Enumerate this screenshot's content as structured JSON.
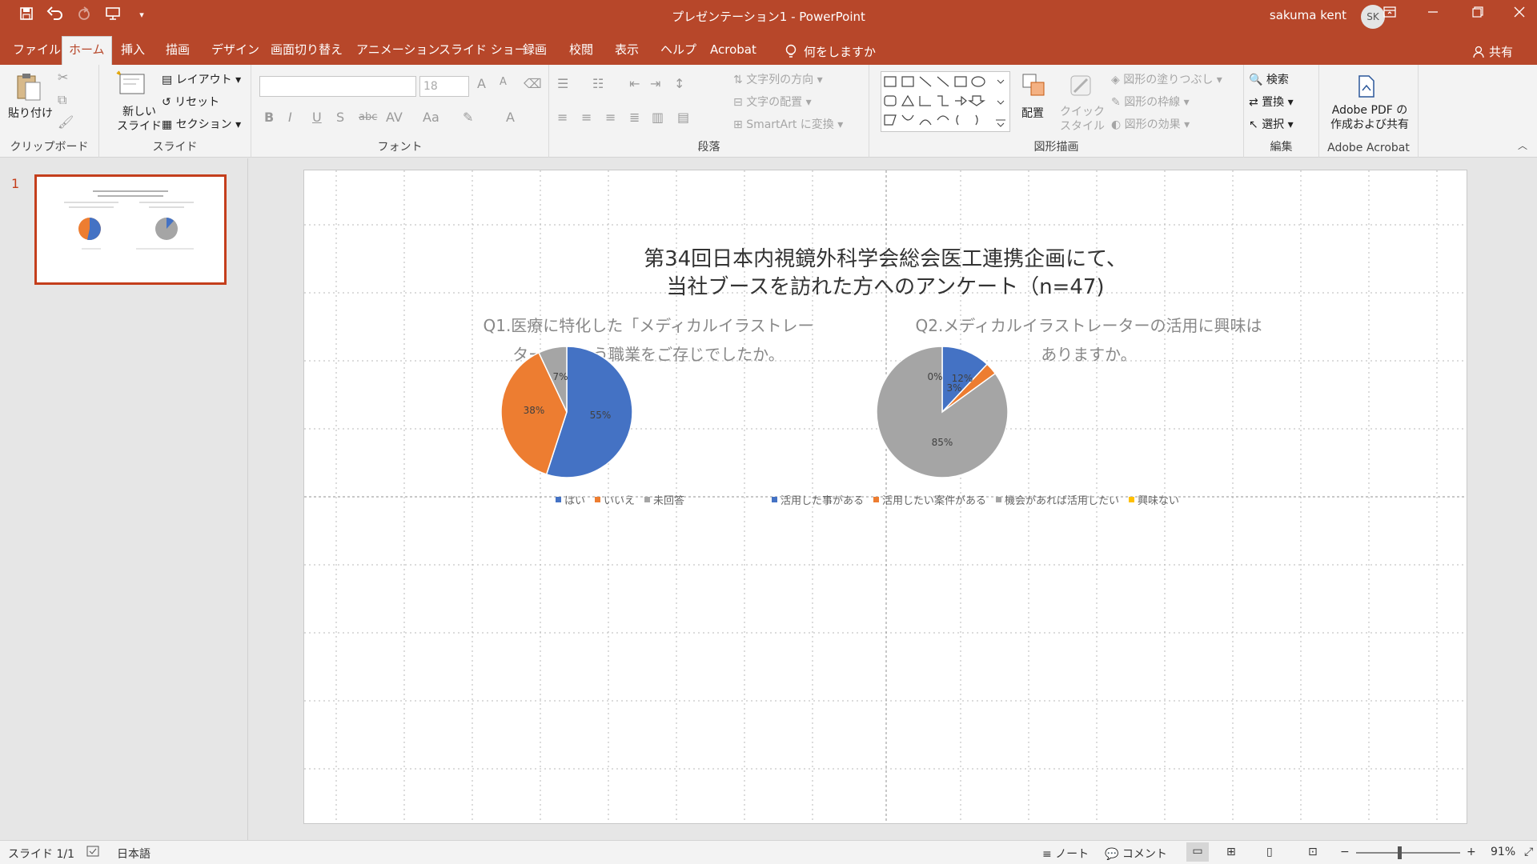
{
  "titlebar": {
    "title": "プレゼンテーション1  -  PowerPoint",
    "user_name": "sakuma kent",
    "avatar_initials": "SK"
  },
  "tabs": [
    "ファイル",
    "ホーム",
    "挿入",
    "描画",
    "デザイン",
    "画面切り替え",
    "アニメーション",
    "スライド ショー",
    "録画",
    "校閲",
    "表示",
    "ヘルプ",
    "Acrobat"
  ],
  "tell_me": "何をしますか",
  "share_label": "共有",
  "ribbon": {
    "clipboard": {
      "paste": "貼り付け",
      "label": "クリップボード"
    },
    "slides": {
      "new_slide_line1": "新しい",
      "new_slide_line2": "スライド",
      "layout": "レイアウト",
      "reset": "リセット",
      "section": "セクション",
      "label": "スライド"
    },
    "font": {
      "font_size": "18",
      "label": "フォント"
    },
    "paragraph": {
      "text_direction": "文字列の方向",
      "align_text": "文字の配置",
      "smartart": "SmartArt に変換",
      "label": "段落"
    },
    "drawing": {
      "arrange": "配置",
      "quick_style_line1": "クイック",
      "quick_style_line2": "スタイル",
      "shape_fill": "図形の塗りつぶし",
      "shape_outline": "図形の枠線",
      "shape_effects": "図形の効果",
      "label": "図形描画"
    },
    "editing": {
      "find": "検索",
      "replace": "置換",
      "select": "選択",
      "label": "編集"
    },
    "acrobat": {
      "line1": "Adobe PDF の",
      "line2": "作成および共有",
      "label": "Adobe Acrobat"
    }
  },
  "slide_pane": {
    "slide_number": "1"
  },
  "slide": {
    "title_line1": "第34回日本内視鏡外科学会総会医工連携企画にて、",
    "title_line2": "当社ブースを訪れた方へのアンケート（n=47)",
    "q1_line1": "Q1.医療に特化した「メディカルイラストレー",
    "q1_line2": "ター」という職業をご存じでしたか。",
    "q2_line1": "Q2.メディカルイラストレーターの活用に興味は",
    "q2_line2": "ありますか。"
  },
  "chart_data": [
    {
      "type": "pie",
      "categories": [
        "はい",
        "いいえ",
        "未回答"
      ],
      "values": [
        55,
        38,
        7
      ],
      "labels": [
        "55%",
        "38%",
        "7%"
      ],
      "colors": [
        "#4472c4",
        "#ed7d31",
        "#a5a5a5"
      ],
      "legend": "bottom"
    },
    {
      "type": "pie",
      "categories": [
        "活用した事がある",
        "活用したい案件がある",
        "機会があれば活用したい",
        "興味ない"
      ],
      "values": [
        12,
        3,
        85,
        0
      ],
      "labels": [
        "12%",
        "3%",
        "85%",
        "0%"
      ],
      "colors": [
        "#4472c4",
        "#ed7d31",
        "#a5a5a5",
        "#ffc000"
      ],
      "legend": "bottom"
    }
  ],
  "statusbar": {
    "slide_info": "スライド 1/1",
    "language": "日本語",
    "notes": "ノート",
    "comments": "コメント",
    "zoom": "91%"
  }
}
